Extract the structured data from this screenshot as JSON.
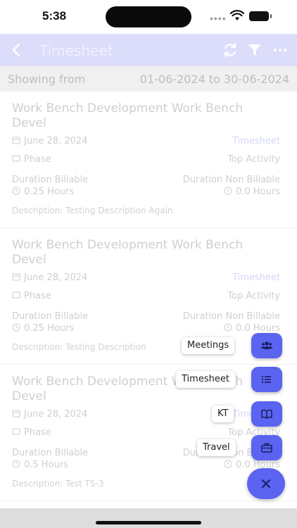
{
  "status_bar": {
    "time": "5:38"
  },
  "header": {
    "title": "Timesheet"
  },
  "range": {
    "label": "Showing from",
    "value": "01-06-2024 to 30-06-2024"
  },
  "entries": [
    {
      "title": "Work Bench Development Work Bench Devel",
      "date": "June 28, 2024",
      "type_link": "Timesheet",
      "phase": "Phase",
      "activity": "Top Activity",
      "billable_label": "Duration Billable",
      "billable_value": "0.25 Hours",
      "nonbillable_label": "Duration Non Billable",
      "nonbillable_value": "0.0 Hours",
      "description": "Description: Testing Description Again."
    },
    {
      "title": "Work Bench Development Work Bench Devel",
      "date": "June 28, 2024",
      "type_link": "Timesheet",
      "phase": "Phase",
      "activity": "Top Activity",
      "billable_label": "Duration Billable",
      "billable_value": "0.25 Hours",
      "nonbillable_label": "Duration Non Billable",
      "nonbillable_value": "0.0 Hours",
      "description": "Description: Testing Description"
    },
    {
      "title": "Work Bench Development Work Bench Devel",
      "date": "June 28, 2024",
      "type_link": "Timesheet",
      "phase": "Phase",
      "activity": "Top Activity",
      "billable_label": "Duration Billable",
      "billable_value": "0.5 Hours",
      "nonbillable_label": "Duration Non Billable",
      "nonbillable_value": "0.0 Hours",
      "description": "Description: Test TS-3"
    }
  ],
  "speed_dial": {
    "meetings": "Meetings",
    "timesheet": "Timesheet",
    "kt": "KT",
    "travel": "Travel"
  },
  "colors": {
    "accent": "#5a64f0",
    "header_bg": "#dcdcfb",
    "link": "#d4d6fb"
  },
  "icons": [
    "back-arrow",
    "refresh",
    "filter",
    "more-horizontal",
    "calendar",
    "tag",
    "clock",
    "users",
    "list",
    "book",
    "briefcase",
    "close"
  ]
}
